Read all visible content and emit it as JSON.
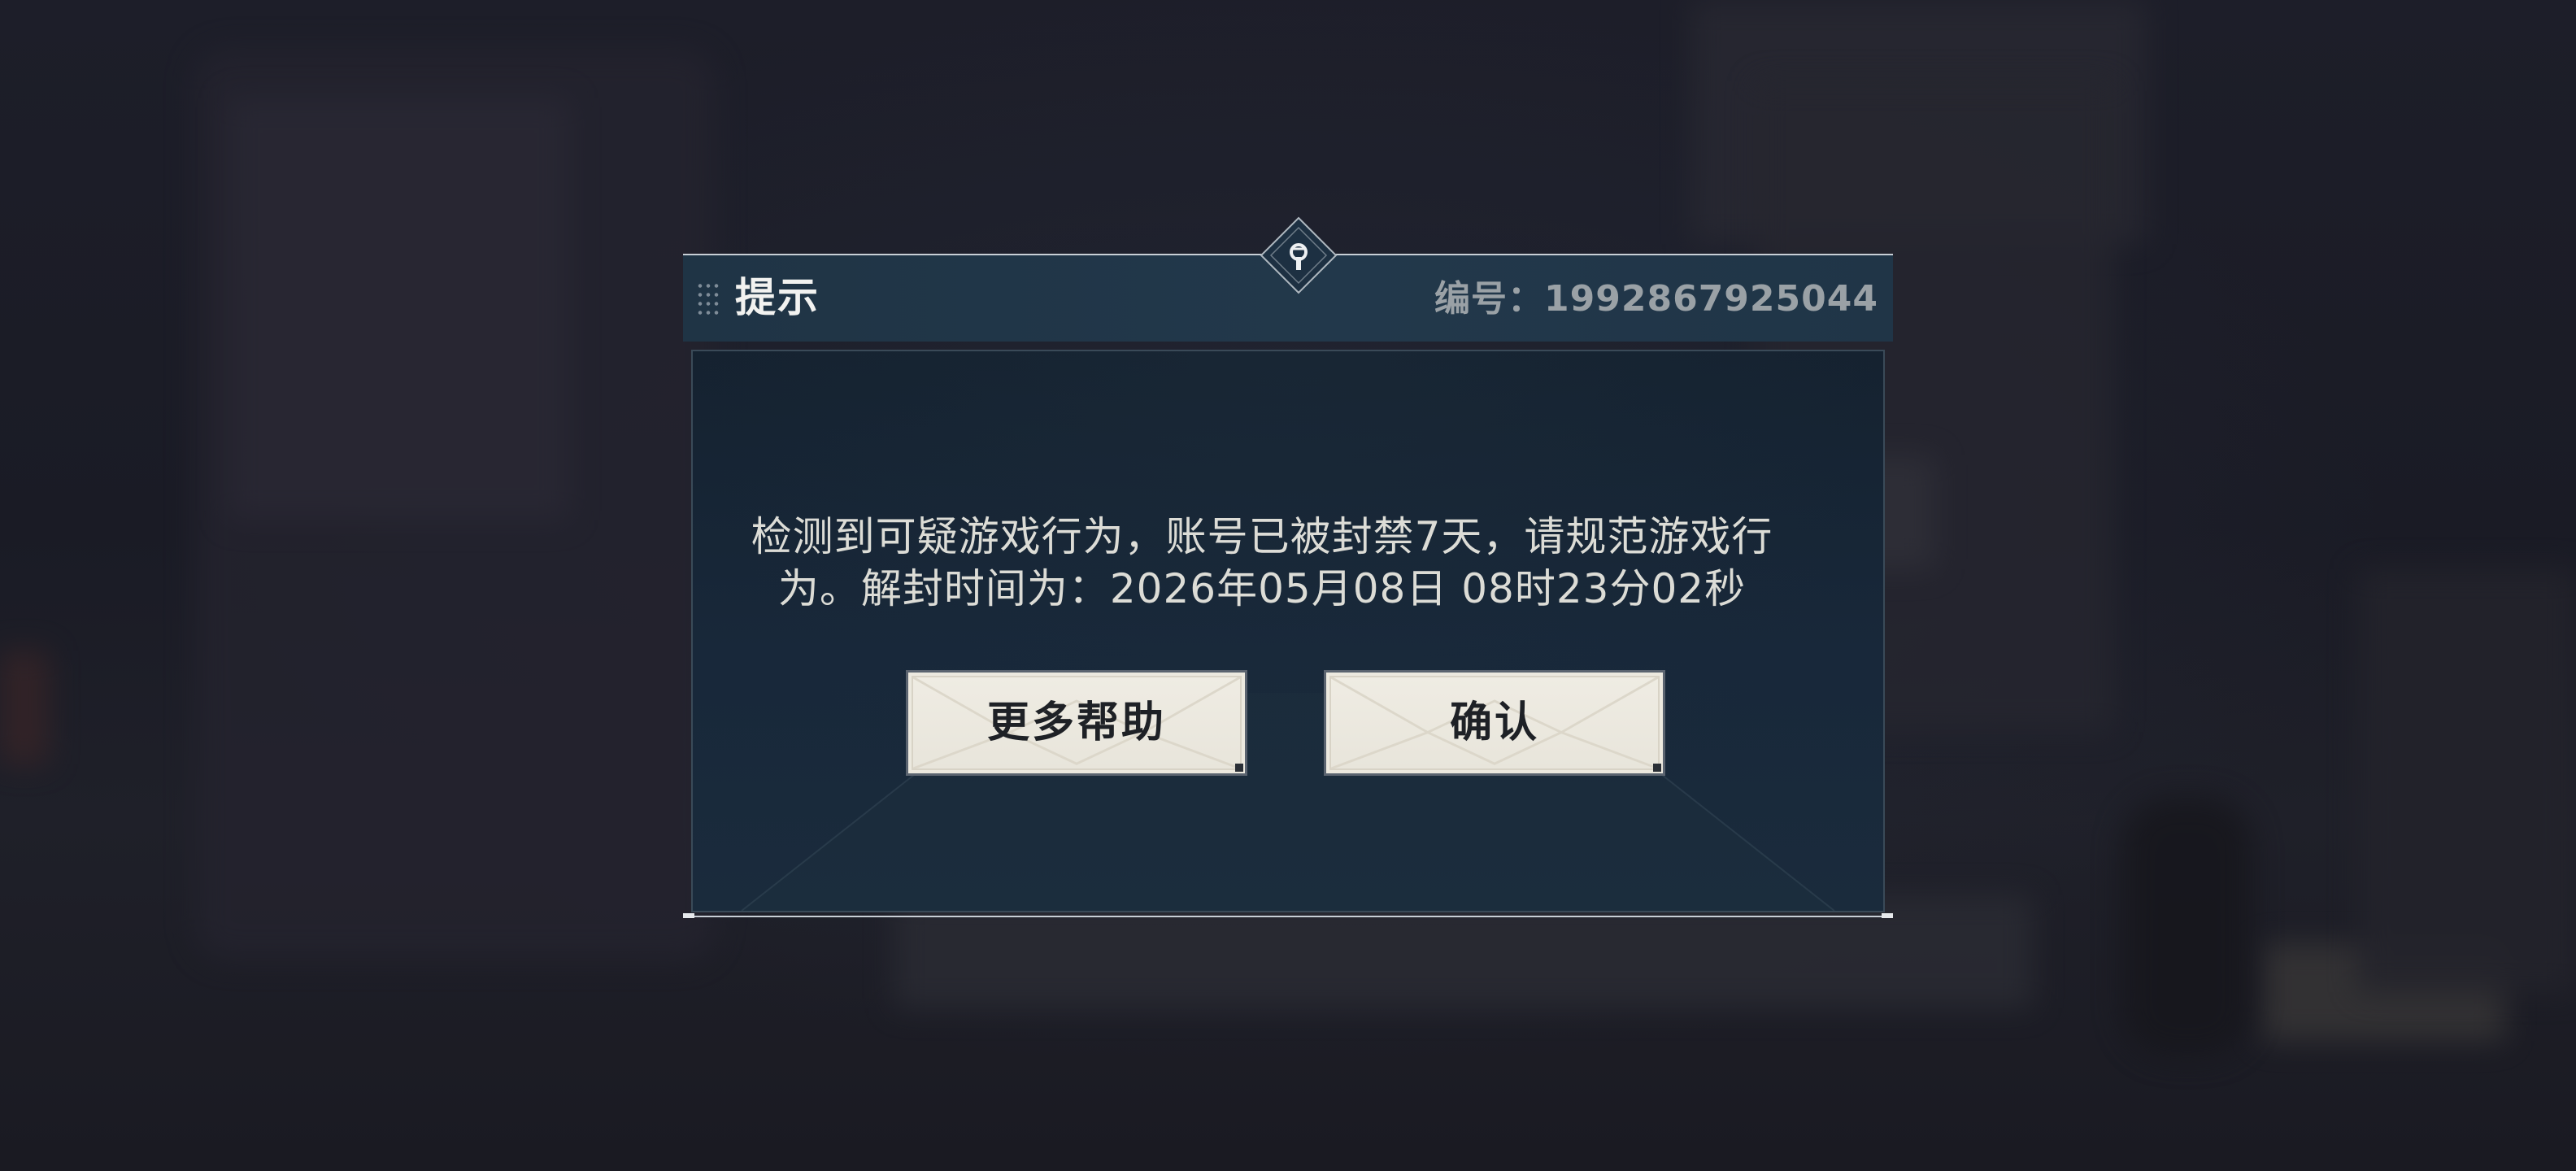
{
  "dialog": {
    "title": "提示",
    "id_text": "编号：1992867925044",
    "message_line1": "检测到可疑游戏行为，账号已被封禁7天，请规范游戏行",
    "message_line2": "为。解封时间为：2026年05月08日 08时23分02秒"
  },
  "buttons": {
    "help_label": "更多帮助",
    "confirm_label": "确认"
  },
  "colors": {
    "header_bg": "#22384b",
    "body_bg": "#18283a",
    "button_bg": "#ece9df",
    "text_light": "#dcdcd6",
    "id_text": "#9aa1a6"
  },
  "icons": {
    "header_emblem": "diamond-emblem-icon",
    "header_grip": "drag-grip-icon"
  }
}
